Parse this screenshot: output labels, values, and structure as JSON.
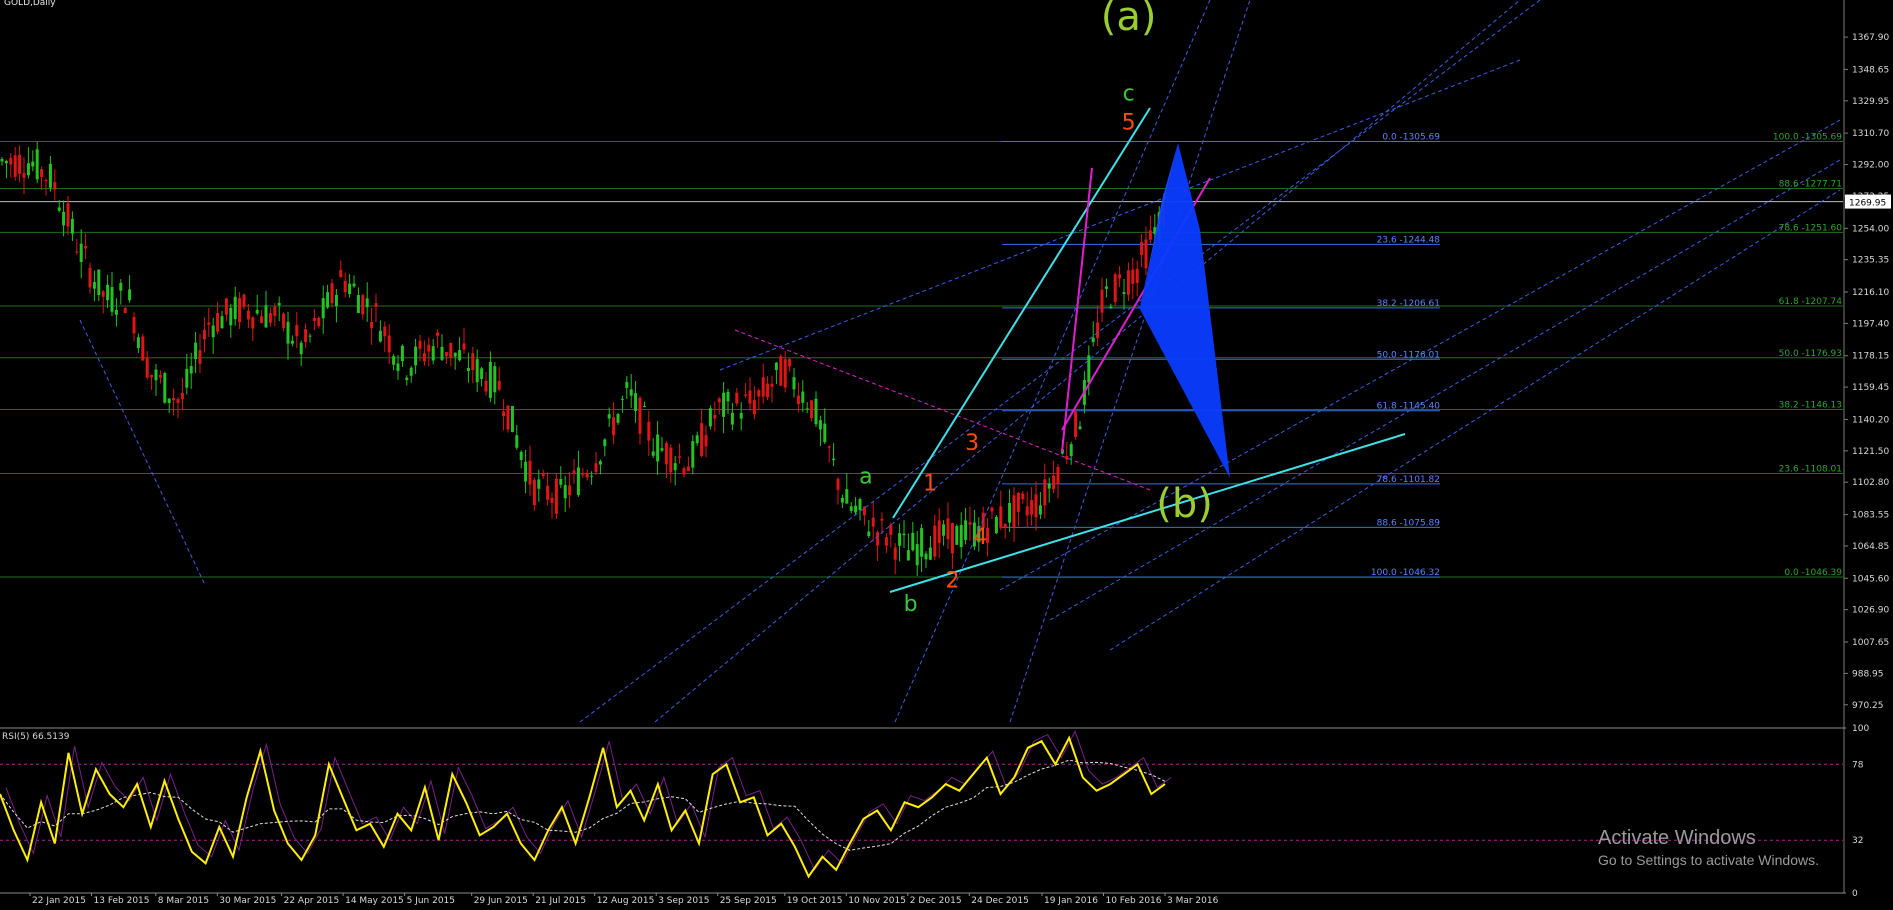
{
  "window": {
    "title": "GOLD,Daily"
  },
  "colors": {
    "background": "#000000",
    "bull": "#22c322",
    "bear": "#e01616",
    "wave_green": "#39c83a",
    "wave_orange": "#ff4a12",
    "wave_big": "#9acd32",
    "fib_blue": "#3b6cf0",
    "fib_green": "#2aa52a",
    "cyan": "#3fe0e8",
    "magenta": "#e020d0",
    "pattern_fill": "#0a3cff",
    "rsi": "#ffee00"
  },
  "chart_data": [
    {
      "type": "candlestick",
      "title": "GOLD,Daily",
      "ylim": [
        960,
        1390
      ],
      "price_axis_ticks": [
        "1367.90",
        "1348.65",
        "1329.95",
        "1310.70",
        "1292.00",
        "1273.25",
        "1254.00",
        "1235.35",
        "1216.10",
        "1197.40",
        "1178.15",
        "1159.45",
        "1140.20",
        "1121.50",
        "1102.80",
        "1083.55",
        "1064.85",
        "1045.60",
        "1026.90",
        "1007.65",
        "988.95",
        "970.25"
      ],
      "current_price": "1269.95",
      "date_axis_ticks": [
        "22 Jan 2015",
        "13 Feb 2015",
        "8 Mar 2015",
        "30 Mar 2015",
        "22 Apr 2015",
        "14 May 2015",
        "5 Jun 2015",
        "29 Jun 2015",
        "21 Jul 2015",
        "12 Aug 2015",
        "3 Sep 2015",
        "25 Sep 2015",
        "19 Oct 2015",
        "10 Nov 2015",
        "2 Dec 2015",
        "24 Dec 2015",
        "19 Jan 2016",
        "10 Feb 2016",
        "3 Mar 2016"
      ],
      "close_path": [
        {
          "date": "22 Jan 2015",
          "close": 1294
        },
        {
          "date": "30 Jan 2015",
          "close": 1283
        },
        {
          "date": "9 Feb 2015",
          "close": 1240
        },
        {
          "date": "18 Feb 2015",
          "close": 1212
        },
        {
          "date": "26 Feb 2015",
          "close": 1214
        },
        {
          "date": "6 Mar 2015",
          "close": 1168
        },
        {
          "date": "17 Mar 2015",
          "close": 1150
        },
        {
          "date": "27 Mar 2015",
          "close": 1198
        },
        {
          "date": "8 Apr 2015",
          "close": 1206
        },
        {
          "date": "20 Apr 2015",
          "close": 1202
        },
        {
          "date": "30 Apr 2015",
          "close": 1182
        },
        {
          "date": "14 May 2015",
          "close": 1225
        },
        {
          "date": "25 May 2015",
          "close": 1204
        },
        {
          "date": "5 Jun 2015",
          "close": 1172
        },
        {
          "date": "17 Jun 2015",
          "close": 1186
        },
        {
          "date": "29 Jun 2015",
          "close": 1172
        },
        {
          "date": "9 Jul 2015",
          "close": 1160
        },
        {
          "date": "21 Jul 2015",
          "close": 1100
        },
        {
          "date": "31 Jul 2015",
          "close": 1094
        },
        {
          "date": "12 Aug 2015",
          "close": 1116
        },
        {
          "date": "24 Aug 2015",
          "close": 1156
        },
        {
          "date": "3 Sep 2015",
          "close": 1124
        },
        {
          "date": "15 Sep 2015",
          "close": 1114
        },
        {
          "date": "25 Sep 2015",
          "close": 1146
        },
        {
          "date": "8 Oct 2015",
          "close": 1150
        },
        {
          "date": "19 Oct 2015",
          "close": 1170
        },
        {
          "date": "29 Oct 2015",
          "close": 1148
        },
        {
          "date": "10 Nov 2015",
          "close": 1090
        },
        {
          "date": "20 Nov 2015",
          "close": 1076
        },
        {
          "date": "2 Dec 2015",
          "close": 1062
        },
        {
          "date": "14 Dec 2015",
          "close": 1070
        },
        {
          "date": "24 Dec 2015",
          "close": 1072
        },
        {
          "date": "5 Jan 2016",
          "close": 1082
        },
        {
          "date": "19 Jan 2016",
          "close": 1092
        },
        {
          "date": "1 Feb 2016",
          "close": 1138
        },
        {
          "date": "10 Feb 2016",
          "close": 1212
        },
        {
          "date": "22 Feb 2016",
          "close": 1230
        },
        {
          "date": "3 Mar 2016",
          "close": 1264
        },
        {
          "date": "8 Mar 2016",
          "close": 1262
        }
      ],
      "fib_right_blue": [
        "0.0 -1305.69",
        "23.6 -1244.48",
        "38.2 -1206.61",
        "50.0 -1176.01",
        "61.8 -1145.40",
        "78.6 -1101.82",
        "88.6 -1075.89",
        "100.0 -1046.32"
      ],
      "fib_right_green": [
        "100.0 -1305.69",
        "88.6 -1277.71",
        "78.6 -1251.60",
        "61.8 -1207.74",
        "50.0 -1176.93",
        "38.2 -1146.13",
        "23.6 -1108.01",
        "0.0 -1046.39"
      ],
      "horizontal_levels": [
        1305.69,
        1277.71,
        1269.95,
        1251.6,
        1207.74,
        1176.93,
        1146.13,
        1108.01,
        1046.39
      ],
      "wave_labels": [
        {
          "text": "(a)",
          "date": "19 Feb 2016",
          "price": 1372,
          "color": "wave_big"
        },
        {
          "text": "c",
          "date": "19 Feb 2016",
          "price": 1330,
          "color": "wave_green"
        },
        {
          "text": "5",
          "date": "19 Feb 2016",
          "price": 1313,
          "color": "wave_orange"
        },
        {
          "text": "a",
          "date": "17 Nov 2015",
          "price": 1102,
          "color": "wave_green"
        },
        {
          "text": "1",
          "date": "10 Dec 2015",
          "price": 1098,
          "color": "wave_orange"
        },
        {
          "text": "3",
          "date": "25 Dec 2015",
          "price": 1122,
          "color": "wave_orange"
        },
        {
          "text": "4",
          "date": "28 Dec 2015",
          "price": 1066,
          "color": "wave_orange"
        },
        {
          "text": "2",
          "date": "18 Dec 2015",
          "price": 1040,
          "color": "wave_orange"
        },
        {
          "text": "b",
          "date": "3 Dec 2015",
          "price": 1026,
          "color": "wave_green"
        },
        {
          "text": "(b)",
          "date": "10 Mar 2016",
          "price": 1082,
          "color": "wave_big"
        }
      ]
    },
    {
      "type": "line",
      "title": "RSI(5) 66.5139",
      "ylim": [
        0,
        100
      ],
      "levels_text": [
        "100",
        "78",
        "32",
        "0"
      ],
      "levels": [
        78,
        32
      ],
      "x_dates": [
        "22 Jan 2015",
        "13 Feb 2015",
        "8 Mar 2015",
        "30 Mar 2015",
        "22 Apr 2015",
        "14 May 2015",
        "5 Jun 2015",
        "29 Jun 2015",
        "21 Jul 2015",
        "12 Aug 2015",
        "3 Sep 2015",
        "25 Sep 2015",
        "19 Oct 2015",
        "10 Nov 2015",
        "2 Dec 2015",
        "24 Dec 2015",
        "19 Jan 2016",
        "10 Feb 2016",
        "3 Mar 2016"
      ],
      "series": [
        {
          "values": [
            60,
            38,
            20,
            55,
            30,
            85,
            48,
            75,
            60,
            52,
            66,
            40,
            68,
            45,
            25,
            18,
            40,
            22,
            58,
            86,
            50,
            30,
            20,
            35,
            78,
            58,
            38,
            42,
            28,
            48,
            38,
            64,
            32,
            72,
            55,
            35,
            40,
            48,
            30,
            20,
            38,
            52,
            30,
            58,
            88,
            52,
            62,
            44,
            66,
            38,
            50,
            30,
            72,
            78,
            55,
            58,
            35,
            42,
            28,
            10,
            22,
            14,
            30,
            45,
            50,
            38,
            55,
            52,
            58,
            66,
            62,
            72,
            82,
            60,
            70,
            88,
            92,
            78,
            94,
            70,
            62,
            66,
            72,
            78,
            60,
            66
          ]
        }
      ]
    }
  ],
  "watermark": {
    "line1": "Activate Windows",
    "line2": "Go to Settings to activate Windows."
  }
}
